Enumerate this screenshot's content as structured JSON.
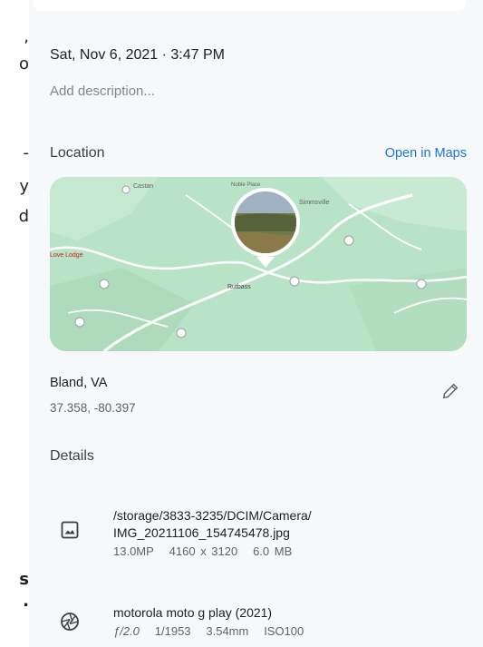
{
  "left_fragments": [
    ",",
    "o",
    "-",
    "y",
    "d",
    "s",
    "."
  ],
  "datetime": "Sat, Nov 6, 2021 · 3:47 PM",
  "description_placeholder": "Add description...",
  "location": {
    "title": "Location",
    "open_maps": "Open in Maps",
    "place": "Bland, VA",
    "coords": "37.358, -80.397"
  },
  "map_labels": {
    "dove_lodge": "Love Lodge",
    "castle": "Castan",
    "noble": "Noble Place",
    "town": "Simmsville",
    "center": "Rutbass"
  },
  "details": {
    "title": "Details",
    "file": {
      "icon": "image-icon",
      "path_line1": "/storage/3833-3235/DCIM/Camera/",
      "path_line2": "IMG_20211106_154745478.jpg",
      "megapixels": "13.0MP",
      "resolution": "4160 x 3120",
      "size": "6.0 MB"
    },
    "camera": {
      "icon": "aperture-icon",
      "model": "motorola moto g play (2021)",
      "aperture": "ƒ/2.0",
      "shutter": "1/1953",
      "focal": "3.54mm",
      "iso": "ISO100"
    }
  },
  "colors": {
    "link": "#1a73e8",
    "map_green": "#b9e3c6",
    "panel_bg": "#f7f8fa"
  }
}
